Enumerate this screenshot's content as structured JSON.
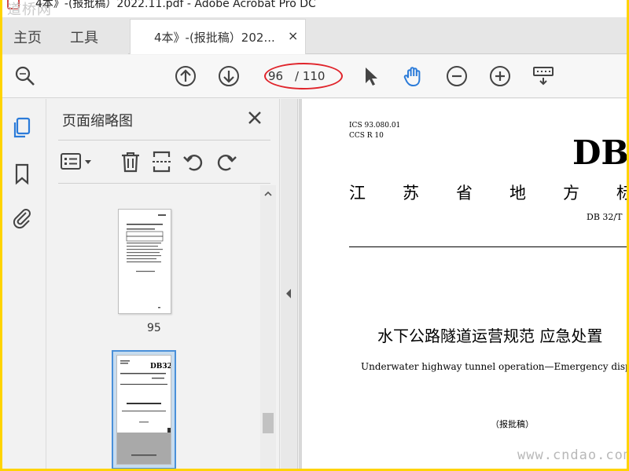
{
  "window": {
    "title": "4本》-(报批稿）2022.11.pdf - Adobe Acrobat Pro DC",
    "watermark_left": "道桥网"
  },
  "tabs": {
    "home": "主页",
    "tools": "工具",
    "document_tab": "4本》-(报批稿）202...",
    "close_glyph": "×"
  },
  "toolbar": {
    "page_current": "96",
    "page_total": "/ 110",
    "accent": "#2b7bd9",
    "highlight": "#e0242b"
  },
  "side_panel": {
    "title": "页面缩略图",
    "thumbnail_numbers": [
      "95"
    ]
  },
  "document": {
    "ics": "ICS 93.080.01",
    "ccs": "CCS R 10",
    "standard_code": "DB",
    "province_chars": [
      "江",
      "苏",
      "省",
      "地",
      "方",
      "标"
    ],
    "db_number": "DB 32/T",
    "title_zh": "水下公路隧道运营规范  应急处置",
    "title_en": "Underwater highway tunnel operation—Emergency disposal specification",
    "draft_label": "（报批稿）",
    "watermark_site": "www.cndao.com"
  }
}
